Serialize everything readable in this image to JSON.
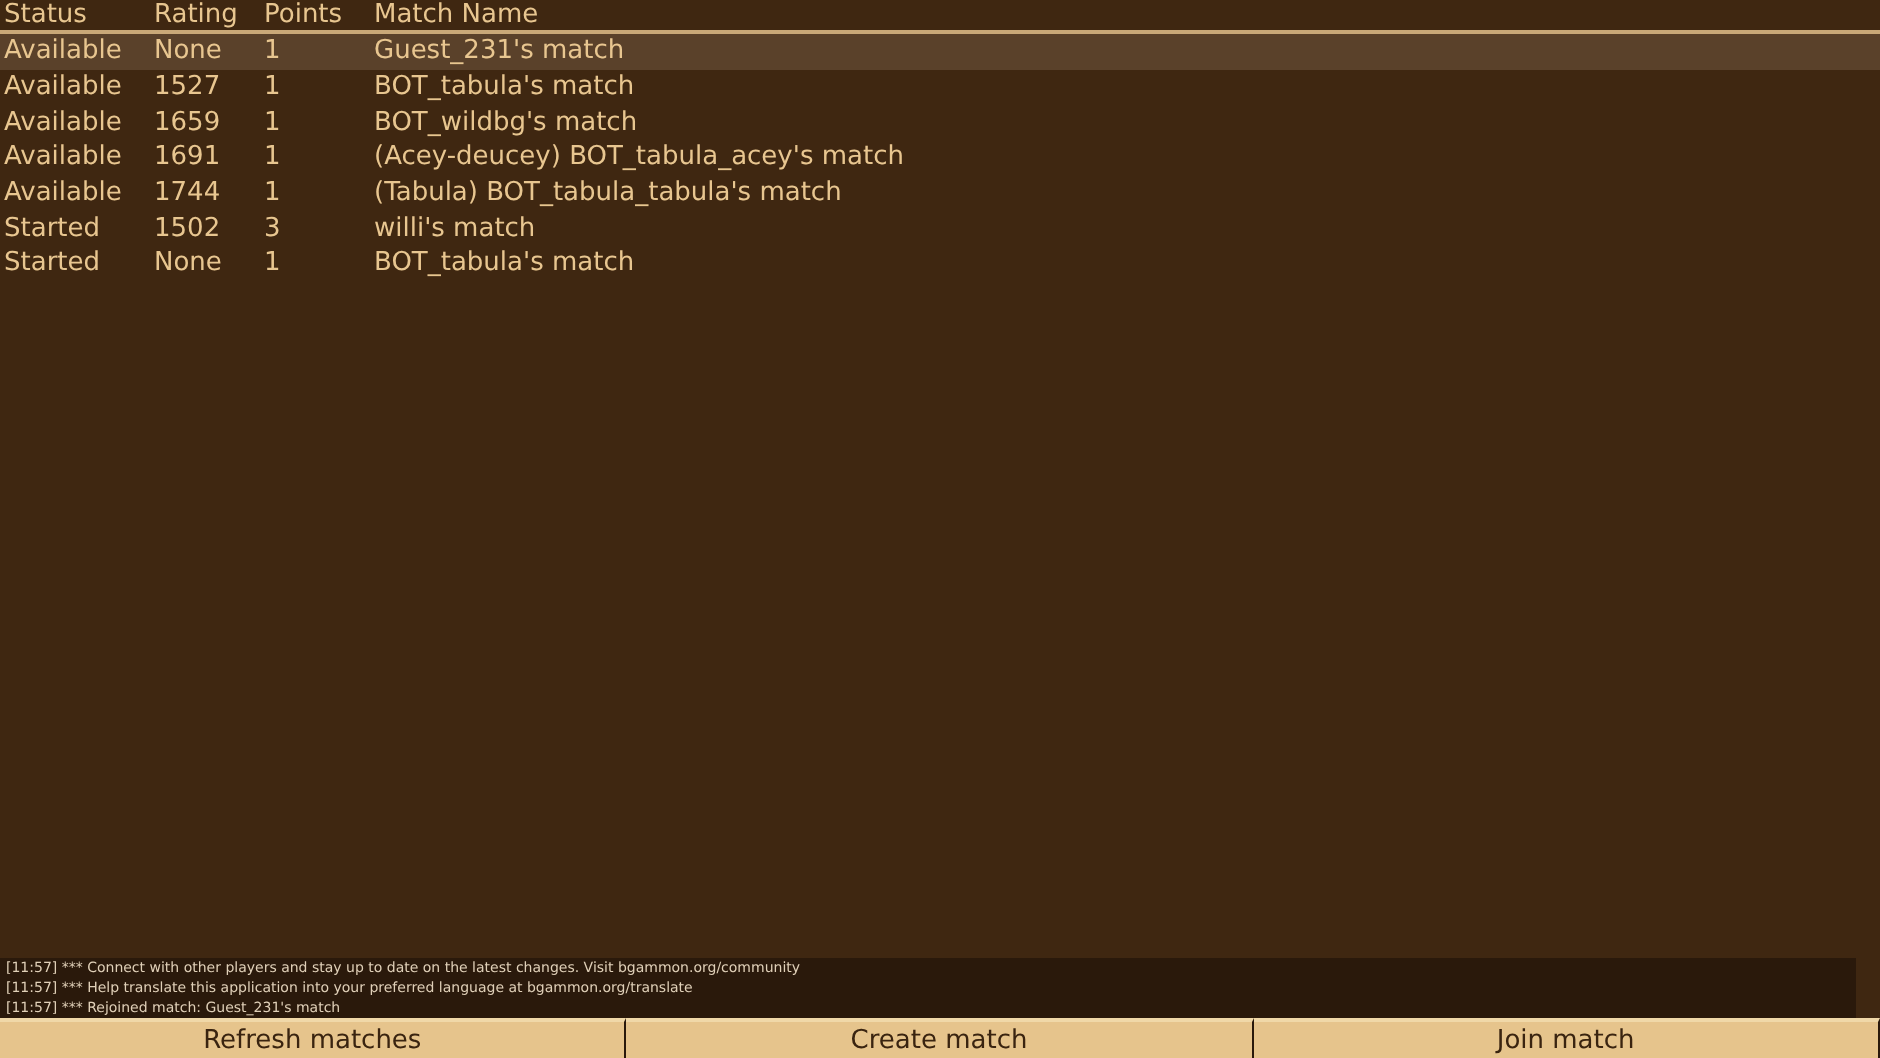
{
  "table": {
    "columns": [
      "Status",
      "Rating",
      "Points",
      "Match Name"
    ],
    "rows": [
      {
        "status": "Available",
        "rating": "None",
        "points": "1",
        "name": "Guest_231's match",
        "selected": true
      },
      {
        "status": "Available",
        "rating": "1527",
        "points": "1",
        "name": "BOT_tabula's match",
        "selected": false
      },
      {
        "status": "Available",
        "rating": "1659",
        "points": "1",
        "name": "BOT_wildbg's match",
        "selected": false
      },
      {
        "status": "Available",
        "rating": "1691",
        "points": "1",
        "name": "(Acey-deucey) BOT_tabula_acey's match",
        "selected": false
      },
      {
        "status": "Available",
        "rating": "1744",
        "points": "1",
        "name": "(Tabula) BOT_tabula_tabula's match",
        "selected": false
      },
      {
        "status": "Started",
        "rating": "1502",
        "points": "3",
        "name": "willi's match",
        "selected": false
      },
      {
        "status": "Started",
        "rating": "None",
        "points": "1",
        "name": "BOT_tabula's match",
        "selected": false
      }
    ]
  },
  "log": [
    "[11:57] *** Connect with other players and stay up to date on the latest changes. Visit bgammon.org/community",
    "[11:57] *** Help translate this application into your preferred language at bgammon.org/translate",
    "[11:57] *** Rejoined match: Guest_231's match"
  ],
  "buttons": [
    "Refresh matches",
    "Create match",
    "Join match"
  ]
}
